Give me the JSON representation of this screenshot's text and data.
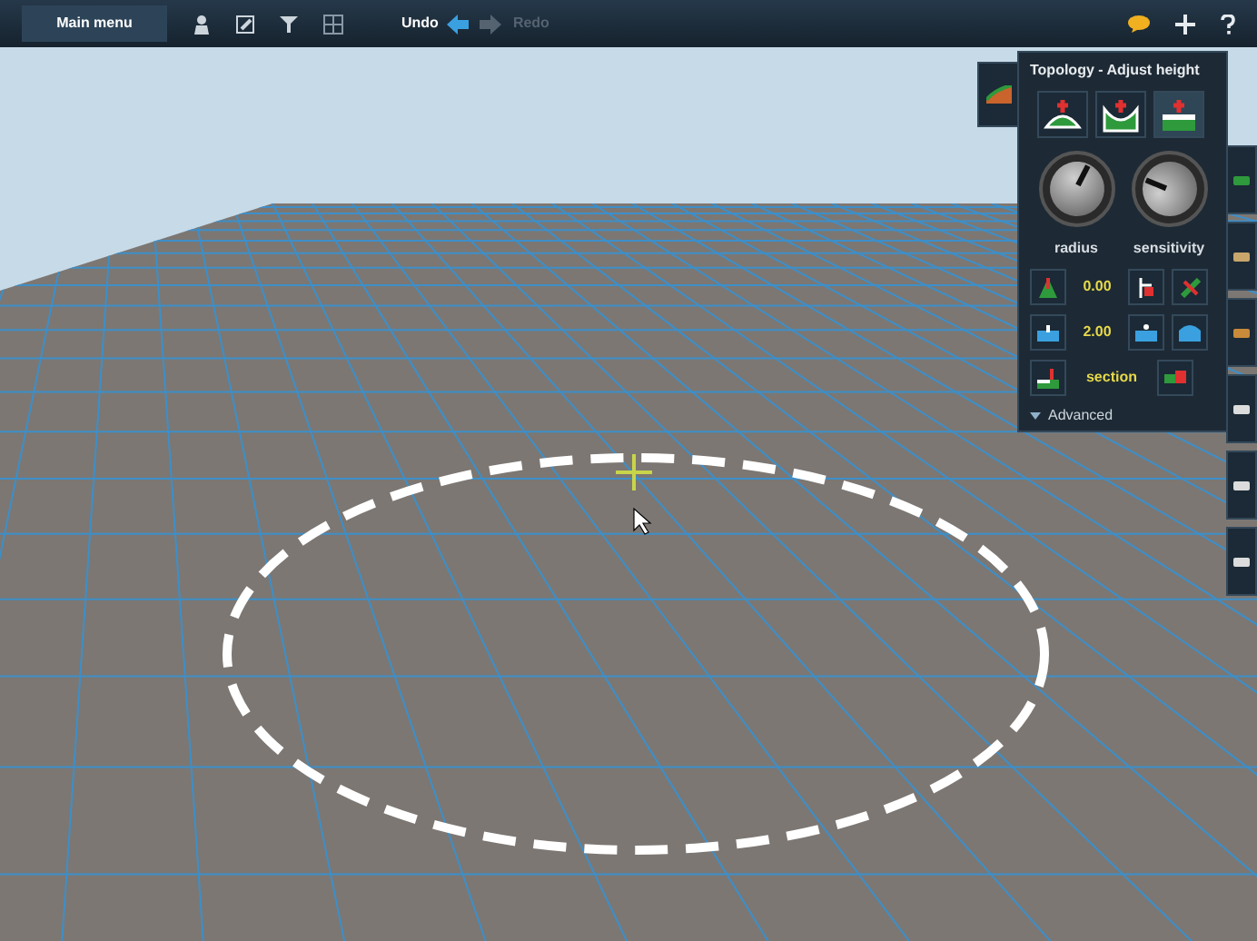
{
  "toolbar": {
    "main_menu": "Main menu",
    "undo": {
      "label": "Undo",
      "disabled": false
    },
    "redo": {
      "label": "Redo",
      "disabled": true
    }
  },
  "panel": {
    "title": "Topology - Adjust height",
    "modes": [
      {
        "kind": "raise",
        "selected": false
      },
      {
        "kind": "lower",
        "selected": false
      },
      {
        "kind": "flatten",
        "selected": true
      }
    ],
    "knobs": [
      {
        "label": "radius",
        "level": 0.6
      },
      {
        "label": "sensitivity",
        "level": 0.25
      }
    ],
    "height_value": "0.00",
    "step_value": "2.00",
    "section_label": "section",
    "advanced": {
      "label": "Advanced",
      "expanded": false
    }
  }
}
